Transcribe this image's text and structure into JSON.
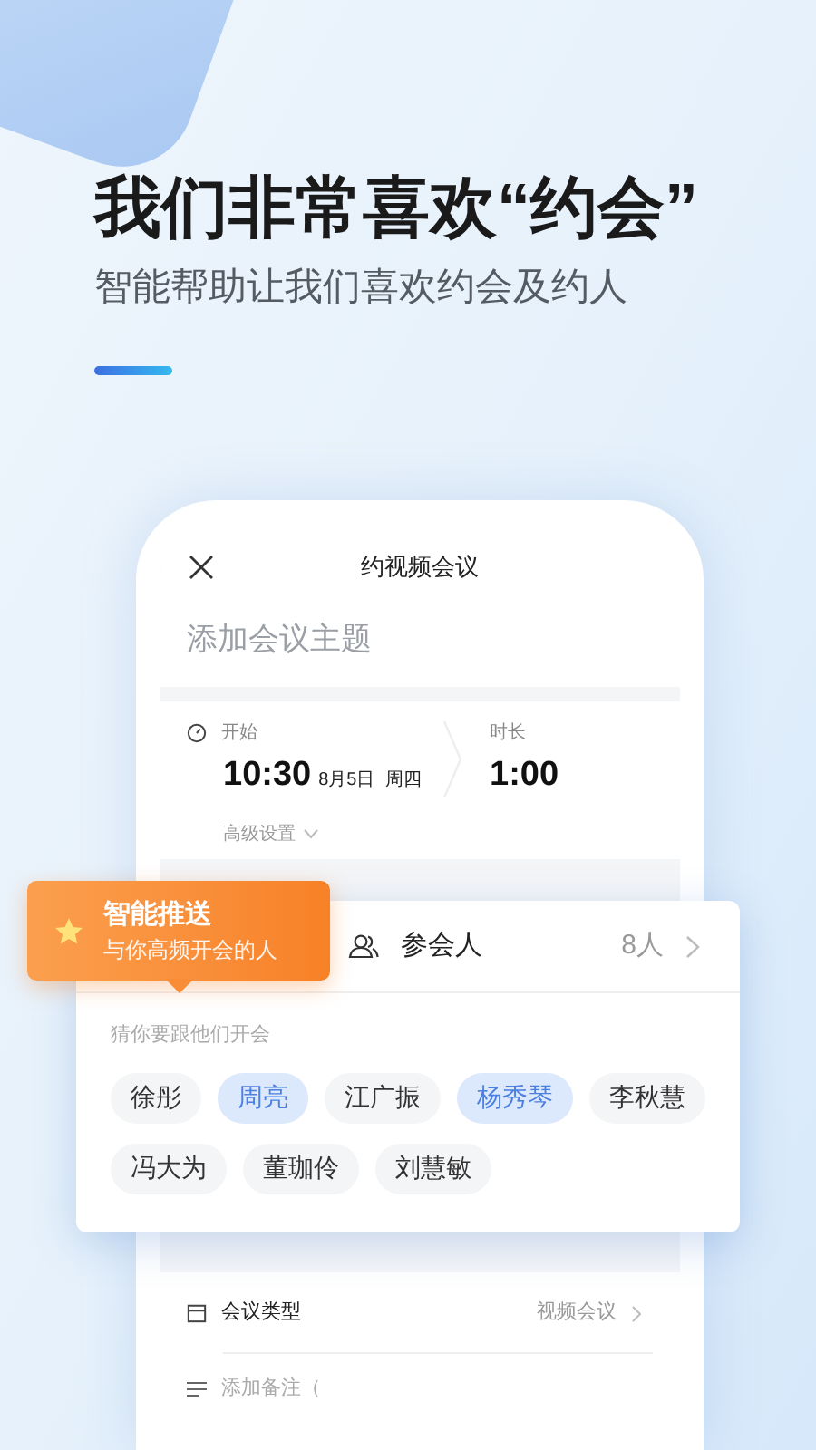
{
  "headline": "我们非常喜欢“约会”",
  "subtitle": "智能帮助让我们喜欢约会及约人",
  "phone": {
    "screen_title": "约视频会议",
    "topic_placeholder": "添加会议主题",
    "start_label": "开始",
    "start_time": "10:30",
    "start_date": "8月5日",
    "start_weekday": "周四",
    "duration_label": "时长",
    "duration": "1:00",
    "advanced_settings": "高级设置",
    "meeting_type_label": "会议类型",
    "meeting_type_value": "视频会议",
    "notes_placeholder": "添加备注（"
  },
  "attendees_card": {
    "label": "参会人",
    "count": "8人",
    "hint": "猜你要跟他们开会",
    "people": [
      {
        "name": "徐彤",
        "selected": false
      },
      {
        "name": "周亮",
        "selected": true
      },
      {
        "name": "江广振",
        "selected": false
      },
      {
        "name": "杨秀琴",
        "selected": true
      },
      {
        "name": "李秋慧",
        "selected": false
      },
      {
        "name": "冯大为",
        "selected": false
      },
      {
        "name": "董珈伶",
        "selected": false
      },
      {
        "name": "刘慧敏",
        "selected": false
      }
    ]
  },
  "tooltip": {
    "title": "智能推送",
    "subtitle": "与你高频开会的人"
  }
}
